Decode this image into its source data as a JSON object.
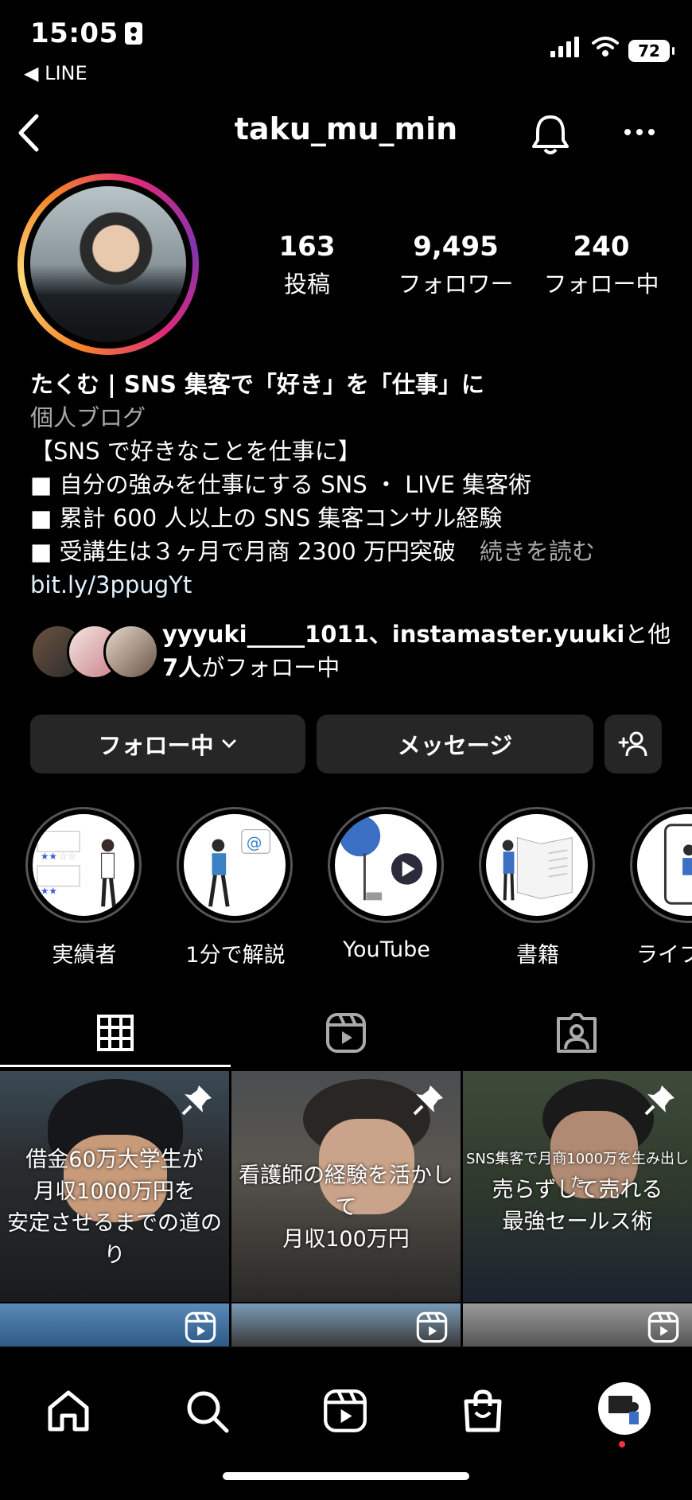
{
  "status_bar": {
    "time": "15:05",
    "back_app": "◀ LINE",
    "battery": "72"
  },
  "header": {
    "username": "taku_mu_min"
  },
  "profile": {
    "stats": [
      {
        "value": "163",
        "label": "投稿"
      },
      {
        "value": "9,495",
        "label": "フォロワー"
      },
      {
        "value": "240",
        "label": "フォロー中"
      }
    ],
    "display_name": "たくむ | SNS 集客で「好き」を「仕事」に",
    "category": "個人ブログ",
    "bio_lines": [
      "【SNS で好きなことを仕事に】",
      "■ 自分の強みを仕事にする SNS ・ LIVE 集客術",
      "■ 累計 600 人以上の SNS 集客コンサル経験",
      "■ 受講生は３ヶ月で月商 2300 万円突破"
    ],
    "more_label": "続きを読む",
    "link": "bit.ly/3ppugYt",
    "mutual": {
      "names": "yyyuki_____1011、instamaster.yuuki",
      "suffix1": "と他",
      "count": "7人",
      "suffix2": "がフォロー中"
    }
  },
  "actions": {
    "following": "フォロー中",
    "message": "メッセージ"
  },
  "highlights": [
    {
      "label": "実績者"
    },
    {
      "label": "1分で解説"
    },
    {
      "label": "YouTube"
    },
    {
      "label": "書籍"
    },
    {
      "label": "ライフ"
    }
  ],
  "posts": [
    {
      "lines": [
        "借金60万大学生が",
        "月収1000万円を",
        "安定させるまでの道のり"
      ]
    },
    {
      "lines": [
        "看護師の経験を活かして",
        "月収100万円"
      ]
    },
    {
      "top": "SNS集客で月商1000万を生み出した",
      "lines": [
        "売らずして売れる",
        "最強セールス術"
      ]
    }
  ]
}
